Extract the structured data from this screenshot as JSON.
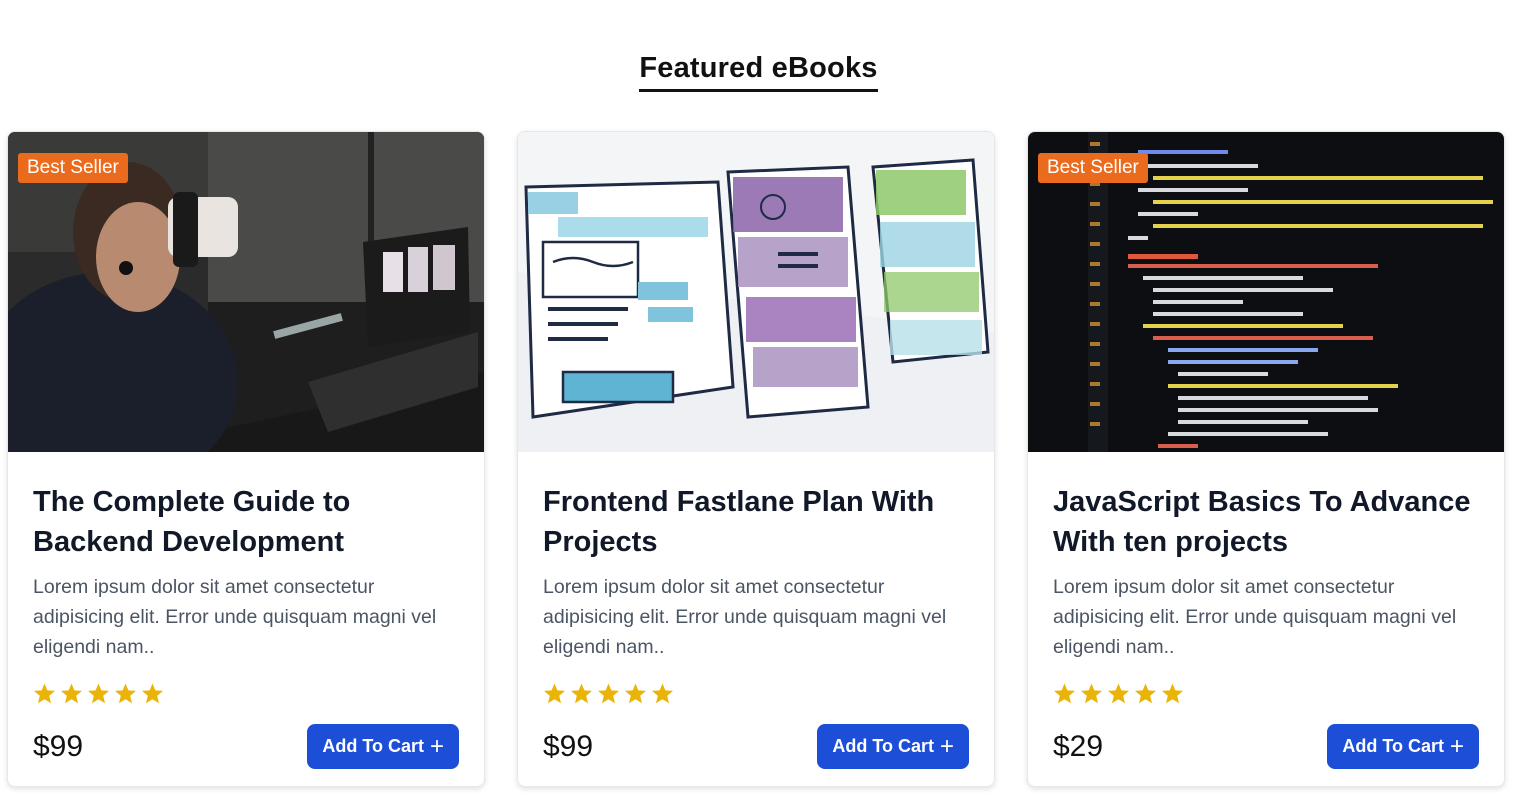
{
  "section": {
    "title": "Featured eBooks"
  },
  "colors": {
    "badge": "#ea6b1d",
    "button": "#1d4ed8",
    "star": "#eab308"
  },
  "cards": [
    {
      "badge": "Best Seller",
      "title": "The Complete Guide to Backend Development",
      "description": "Lorem ipsum dolor sit amet consectetur adipisicing elit. Error unde quisquam magni vel eligendi nam..",
      "rating": 5,
      "price": "$99",
      "button_label": "Add To Cart",
      "button_icon": "+",
      "image_icon": "person-drinking-at-laptop-photo"
    },
    {
      "badge": "",
      "title": "Frontend Fastlane Plan With Projects",
      "description": "Lorem ipsum dolor sit amet consectetur adipisicing elit. Error unde quisquam magni vel eligendi nam..",
      "rating": 5,
      "price": "$99",
      "button_label": "Add To Cart",
      "button_icon": "+",
      "image_icon": "wireframe-sketch-photo"
    },
    {
      "badge": "Best Seller",
      "title": "JavaScript Basics To Advance With ten projects",
      "description": "Lorem ipsum dolor sit amet consectetur adipisicing elit. Error unde quisquam magni vel eligendi nam..",
      "rating": 5,
      "price": "$29",
      "button_label": "Add To Cart",
      "button_icon": "+",
      "image_icon": "code-editor-photo"
    }
  ]
}
